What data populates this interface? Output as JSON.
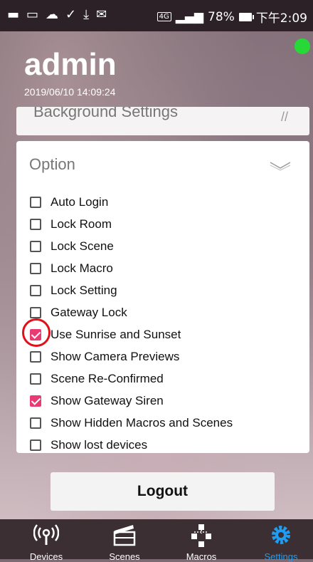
{
  "status_bar": {
    "network": "4G",
    "battery": "78%",
    "time": "下午2:09",
    "notification_icons": [
      "message-icon",
      "mail-icon",
      "cloud-icon",
      "check-icon",
      "download-icon",
      "envelope-icon"
    ]
  },
  "header": {
    "title": "admin",
    "datetime": "2019/06/10 14:09:24",
    "online_color": "#27d936"
  },
  "background_settings": {
    "label": "Background Settings"
  },
  "option_panel": {
    "title": "Option",
    "items": [
      {
        "label": "Auto Login",
        "checked": false
      },
      {
        "label": "Lock Room",
        "checked": false
      },
      {
        "label": "Lock Scene",
        "checked": false
      },
      {
        "label": "Lock Macro",
        "checked": false
      },
      {
        "label": "Lock Setting",
        "checked": false
      },
      {
        "label": "Gateway Lock",
        "checked": false
      },
      {
        "label": "Use Sunrise and Sunset",
        "checked": true
      },
      {
        "label": "Show Camera Previews",
        "checked": false
      },
      {
        "label": "Scene Re-Confirmed",
        "checked": false
      },
      {
        "label": "Show Gateway Siren",
        "checked": true
      },
      {
        "label": "Show Hidden Macros and Scenes",
        "checked": false
      },
      {
        "label": "Show lost devices",
        "checked": false
      }
    ]
  },
  "logout_label": "Logout",
  "tabs": [
    {
      "label": "Devices",
      "icon": "antenna-icon",
      "active": false
    },
    {
      "label": "Scenes",
      "icon": "clapperboard-icon",
      "active": false
    },
    {
      "label": "Macros",
      "icon": "flow-icon",
      "active": false
    },
    {
      "label": "Settings",
      "icon": "gear-icon",
      "active": true
    }
  ],
  "colors": {
    "accent": "#ea3a73",
    "active_tab": "#1e9df2"
  }
}
